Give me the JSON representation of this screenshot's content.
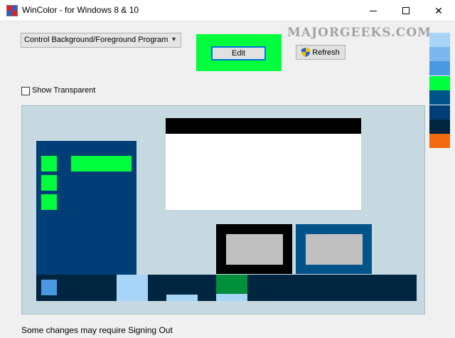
{
  "window": {
    "title": "WinColor - for Windows 8 & 10",
    "minimize_glyph": "—",
    "close_glyph": "✕"
  },
  "controls": {
    "program_select_value": "Control Background/Foreground Program",
    "edit_label": "Edit",
    "refresh_label": "Refresh",
    "show_transparent_label": "Show Transparent",
    "show_transparent_checked": false,
    "current_color": "#00ff3c"
  },
  "watermark": "MAJORGEEKS.COM",
  "swatches": [
    "#a8d4f7",
    "#7ab8ee",
    "#4a98e0",
    "#00ff3c",
    "#00548a",
    "#003e78",
    "#002540",
    "#f26a11"
  ],
  "preview_colors": {
    "panel_bg": "#c6d8e0",
    "start_menu": "#003e78",
    "tile_accent": "#00ff3c",
    "dialog_titlebar": "#000000",
    "dialog_body": "#ffffff",
    "inactive_window_frame": "#000000",
    "active_window_frame": "#00548a",
    "window_content": "#c0c0c0",
    "taskbar": "#002540",
    "start_button": "#4a98e0",
    "taskbar_highlight": "#a8d4f7",
    "taskbar_green": "#008f3a"
  },
  "status": {
    "text": "Some changes may require Signing Out"
  }
}
